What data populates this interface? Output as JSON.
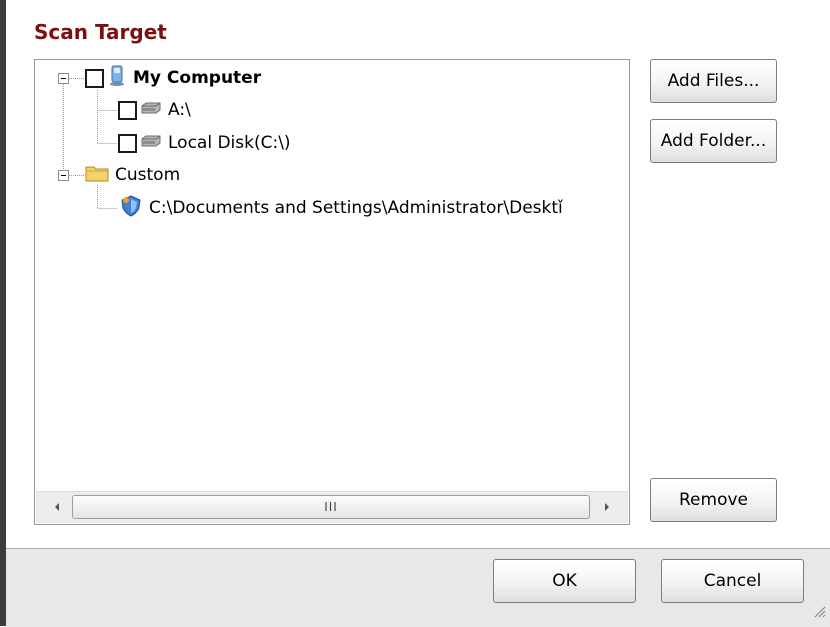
{
  "section_title": "Scan Target",
  "tree": {
    "items": [
      {
        "label": "My Computer"
      },
      {
        "label": "A:\\"
      },
      {
        "label": "Local Disk(C:\\)"
      },
      {
        "label": "Custom"
      },
      {
        "label": "C:\\Documents and Settings\\Administrator\\Desktǐ"
      }
    ]
  },
  "scrollbar": {
    "grip": "III"
  },
  "buttons": {
    "add_files": "Add Files...",
    "add_folder": "Add Folder...",
    "remove": "Remove",
    "ok": "OK",
    "cancel": "Cancel"
  },
  "icons": {
    "computer": "computer-icon",
    "drive": "drive-icon",
    "folder": "folder-icon",
    "shield": "shield-icon"
  }
}
